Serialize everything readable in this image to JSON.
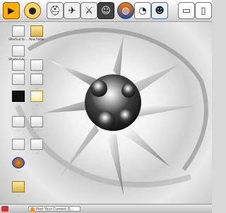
{
  "toolbar": {
    "icons": [
      "play-icon",
      "record-icon",
      "helmet-icon",
      "bird-icon",
      "sword-icon",
      "portrait-icon",
      "firefox-icon",
      "chart-icon",
      "messenger-icon",
      "monitor-icon",
      "tablet-icon"
    ]
  },
  "desktop": {
    "icons": [
      {
        "label": "Shortcut to ..."
      },
      {
        "label": "New folder"
      },
      {
        "label": "Shortcut to ..."
      },
      {
        "label": "..."
      },
      {
        "label": "..."
      },
      {
        "label": "..."
      },
      {
        "label": "..."
      },
      {
        "label": "..."
      },
      {
        "label": "..."
      },
      {
        "label": "..."
      },
      {
        "label": "..."
      },
      {
        "label": "..."
      },
      {
        "label": "..."
      },
      {
        "label": "..."
      },
      {
        "label": "..."
      },
      {
        "label": "..."
      },
      {
        "label": "..."
      }
    ]
  },
  "taskbar": {
    "item": "Post Your Current D..."
  }
}
